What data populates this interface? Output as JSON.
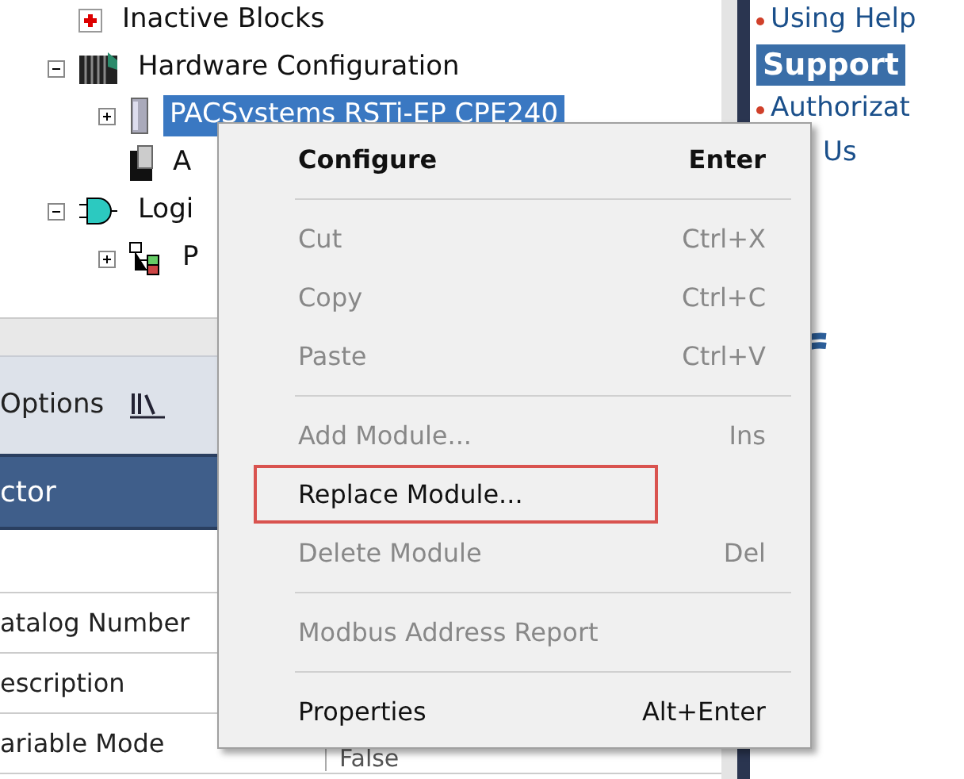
{
  "tree": [
    {
      "label": "Inactive Blocks",
      "kind": "inactive",
      "selected": false
    },
    {
      "label": "Hardware Configuration",
      "kind": "hardware",
      "expanded": true,
      "selected": false,
      "children": [
        {
          "label": "PACSystems RSTi-EP CPE240",
          "kind": "cpu",
          "expanded": false,
          "selected": true
        },
        {
          "label": "A",
          "kind": "module",
          "selected": false
        }
      ]
    },
    {
      "label": "Logi",
      "kind": "logic",
      "expanded": true,
      "selected": false,
      "children": [
        {
          "label": "P",
          "kind": "program",
          "expanded": false,
          "selected": false
        }
      ]
    }
  ],
  "help": [
    {
      "text": "Using Help",
      "kind": "link"
    },
    {
      "text": "Support",
      "kind": "heading"
    },
    {
      "text": "Authorizat",
      "kind": "link"
    },
    {
      "text": "Us",
      "kind": "sublink"
    }
  ],
  "toolbar": {
    "label": "Options"
  },
  "inspector": {
    "title": "ctor",
    "rows": [
      {
        "name": "atalog Number"
      },
      {
        "name": "escription"
      },
      {
        "name": "ariable Mode",
        "value": "False"
      }
    ]
  },
  "menu": [
    {
      "kind": "item",
      "label": "Configure",
      "shortcut": "Enter",
      "default": true,
      "disabled": false,
      "highlighted": false
    },
    {
      "kind": "separator"
    },
    {
      "kind": "item",
      "label": "Cut",
      "shortcut": "Ctrl+X",
      "default": false,
      "disabled": true,
      "highlighted": false
    },
    {
      "kind": "item",
      "label": "Copy",
      "shortcut": "Ctrl+C",
      "default": false,
      "disabled": true,
      "highlighted": false
    },
    {
      "kind": "item",
      "label": "Paste",
      "shortcut": "Ctrl+V",
      "default": false,
      "disabled": true,
      "highlighted": false
    },
    {
      "kind": "separator"
    },
    {
      "kind": "item",
      "label": "Add Module...",
      "shortcut": "Ins",
      "default": false,
      "disabled": true,
      "highlighted": false
    },
    {
      "kind": "item",
      "label": "Replace Module...",
      "default": false,
      "disabled": false,
      "highlighted": true
    },
    {
      "kind": "item",
      "label": "Delete Module",
      "shortcut": "Del",
      "default": false,
      "disabled": true,
      "highlighted": false
    },
    {
      "kind": "separator"
    },
    {
      "kind": "item",
      "label": "Modbus Address Report",
      "default": false,
      "disabled": true,
      "highlighted": false
    },
    {
      "kind": "separator"
    },
    {
      "kind": "item",
      "label": "Properties",
      "shortcut": "Alt+Enter",
      "default": false,
      "disabled": false,
      "highlighted": false
    }
  ]
}
